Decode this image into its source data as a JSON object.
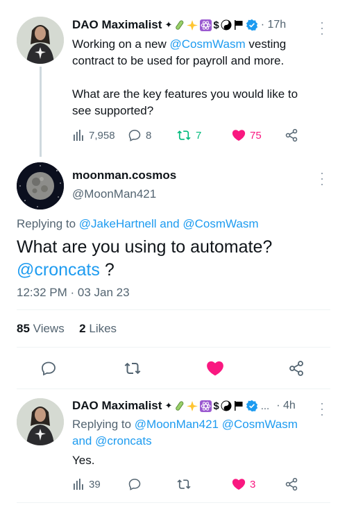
{
  "tweet1": {
    "author": "DAO Maximalist",
    "emoji_flair": [
      "✦",
      "🧪",
      "✨",
      "⚛",
      "$",
      "☯",
      "⚑"
    ],
    "time": "· 17h",
    "text_prefix": "Working on a new ",
    "mention": "@CosmWasm",
    "text_suffix": " vesting",
    "line2": "contract to be used for payroll and more.",
    "line3": "What are the key features you would like to",
    "line4": "see supported?",
    "views": "7,958",
    "replies": "8",
    "retweets": "7",
    "likes": "75"
  },
  "tweet2": {
    "author": "moonman.cosmos",
    "handle": "@MoonMan421",
    "replying_prefix": "Replying to ",
    "replying_user1": "@JakeHartnell",
    "replying_and": " and ",
    "replying_user2": "@CosmWasm",
    "text": "What are you using to automate?",
    "text_mention": "@croncats",
    "text_end": " ?",
    "timestamp": "12:32 PM · 03 Jan 23",
    "views_count": "85",
    "views_label": "Views",
    "likes_count": "2",
    "likes_label": "Likes"
  },
  "tweet3": {
    "author": "DAO Maximalist",
    "ellipsis": "...",
    "time": "· 4h",
    "replying_prefix": "Replying to ",
    "replying_user1": "@MoonMan421",
    "replying_user2": "@CosmWasm",
    "replying_and": "and ",
    "replying_user3": "@croncats",
    "text": "Yes.",
    "views": "39",
    "likes": "3"
  },
  "colors": {
    "accent": "#1d9bf0",
    "like": "#f91880",
    "retweet": "#00ba7c",
    "muted": "#536471"
  }
}
